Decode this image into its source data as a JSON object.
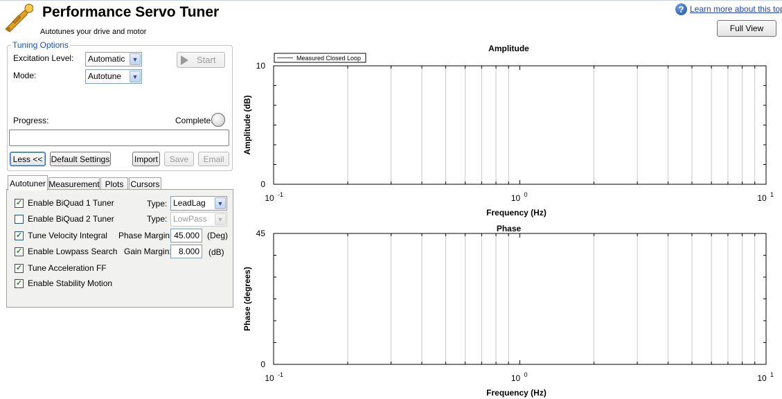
{
  "header": {
    "title": "Performance Servo Tuner",
    "subtitle": "Autotunes your drive and motor",
    "help_link": "Learn more about this topic",
    "full_view_button": "Full View"
  },
  "tuning_options": {
    "group_title": "Tuning Options",
    "excitation_label": "Excitation Level:",
    "excitation_value": "Automatic",
    "mode_label": "Mode:",
    "mode_value": "Autotune",
    "start_button": "Start",
    "progress_label": "Progress:",
    "complete_label": "Complete:",
    "buttons": {
      "less": "Less <<",
      "default_settings": "Default Settings",
      "import": "Import",
      "save": "Save",
      "email": "Email"
    }
  },
  "tabs": [
    {
      "label": "Autotuner",
      "active": true
    },
    {
      "label": "Measurement",
      "active": false
    },
    {
      "label": "Plots",
      "active": false
    },
    {
      "label": "Cursors",
      "active": false
    }
  ],
  "autotuner": {
    "checkboxes": [
      {
        "label": "Enable BiQuad 1 Tuner",
        "checked": true
      },
      {
        "label": "Enable BiQuad 2 Tuner",
        "checked": false
      },
      {
        "label": "Tune Velocity Integral",
        "checked": true
      },
      {
        "label": "Enable Lowpass Search",
        "checked": true
      },
      {
        "label": "Tune Acceleration FF",
        "checked": true
      },
      {
        "label": "Enable Stability Motion",
        "checked": true
      }
    ],
    "type1_label": "Type:",
    "type1_value": "LeadLag",
    "type2_label": "Type:",
    "type2_value": "LowPass",
    "phase_margin_label": "Phase Margin:",
    "phase_margin_value": "45.000",
    "phase_margin_unit": "(Deg)",
    "gain_margin_label": "Gain Margin:",
    "gain_margin_value": "8.000",
    "gain_margin_unit": "(dB)"
  },
  "colors": {
    "accent": "#1c4fb8",
    "link": "#1a3fd6",
    "series_line": "#a03030",
    "gridline": "#c8c8c8"
  },
  "chart_data": [
    {
      "type": "line",
      "title": "Amplitude",
      "xlabel": "Frequency (Hz)",
      "ylabel": "Amplitude (dB)",
      "xscale": "log",
      "xlim": [
        0.1,
        10
      ],
      "ylim": [
        0,
        10
      ],
      "ytick_labels": [
        "10",
        "0"
      ],
      "legend": [
        "Measured Closed Loop"
      ],
      "legend_position": "top-left",
      "grid": true,
      "series": [
        {
          "name": "Measured Closed Loop",
          "x": [],
          "y": []
        }
      ]
    },
    {
      "type": "line",
      "title": "Phase",
      "xlabel": "Frequency (Hz)",
      "ylabel": "Phase (degrees)",
      "xscale": "log",
      "xlim": [
        0.1,
        10
      ],
      "ylim": [
        0,
        45
      ],
      "ytick_labels": [
        "45",
        "0"
      ],
      "grid": true,
      "series": []
    }
  ]
}
